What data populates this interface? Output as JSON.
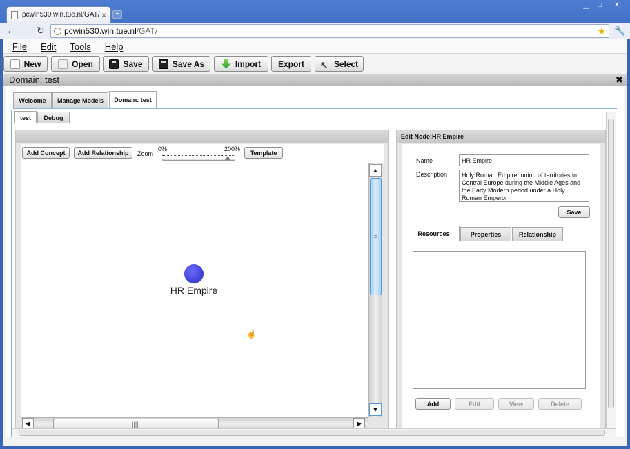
{
  "browser": {
    "tab_title": "pcwin530.win.tue.nl/GAT/",
    "tab_close": "×",
    "new_tab": "+",
    "url_host": "pcwin530.win.tue.nl",
    "url_path": "/GAT/",
    "back": "←",
    "forward": "→",
    "reload": "↻",
    "star": "★",
    "wrench": "🔧",
    "min": "▁",
    "max": "□",
    "close": "✕"
  },
  "menubar": [
    "File",
    "Edit",
    "Tools",
    "Help"
  ],
  "toolbar": {
    "new": "New",
    "open": "Open",
    "save": "Save",
    "save_as": "Save As",
    "import": "Import",
    "export": "Export",
    "select": "Select",
    "select_icon": "↖"
  },
  "domain_bar": {
    "title": "Domain: test",
    "close": "✖"
  },
  "main_tabs": [
    "Welcome",
    "Manage Models",
    "Domain: test"
  ],
  "sub_tabs": [
    "test",
    "Debug"
  ],
  "canvas": {
    "add_concept": "Add Concept",
    "add_relationship": "Add Relationship",
    "zoom_label": "Zoom",
    "zoom_min": "0%",
    "zoom_max": "200%",
    "zoom_level": 0.9,
    "template": "Template",
    "node_label": "HR Empire",
    "node_color": "#2a2ac8",
    "cursor": "☝",
    "scroll_up": "▲",
    "scroll_down": "▼",
    "scroll_left": "◀",
    "scroll_right": "▶",
    "grip_v": "≡",
    "grip_h": "|||||"
  },
  "edit_node": {
    "header": "Edit Node:HR Empire",
    "name_label": "Name",
    "name_value": "HR Empire",
    "description_label": "Description",
    "description_value": "Holy Roman Empire:  union of territories in Central Europe during the Middle Ages and the Early Modern period under a Holy Roman Emperor",
    "save": "Save",
    "tabs": [
      "Resources",
      "Properties",
      "Relationship"
    ],
    "buttons": {
      "add": "Add",
      "edit": "Edit",
      "view": "View",
      "delete": "Delete"
    }
  }
}
